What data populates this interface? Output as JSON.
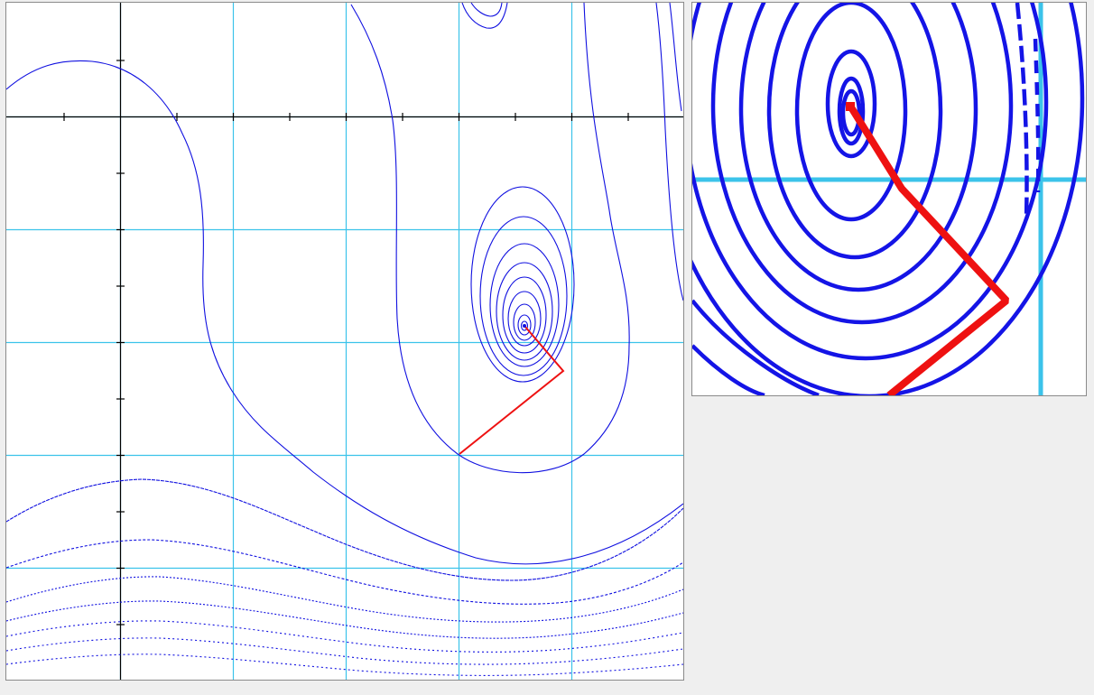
{
  "app": {
    "description_visible": false
  },
  "colors": {
    "background": "#efefef",
    "plot_background": "#ffffff",
    "panel_border": "#8a8a8a",
    "grid": "#3bc3ea",
    "axis": "#000000",
    "contour": "#1010e0",
    "path": "#ee1111"
  },
  "main_plot": {
    "grid_divisions": 6,
    "axis_ticks_per_cell": 2,
    "contours": "contour-lines",
    "path": "red-descent-path",
    "minimum_marker": "minimum-point"
  },
  "zoom_plot": {
    "description_visible": false,
    "contours": "zoomed-contour-lines",
    "path": "zoomed-red-path"
  }
}
